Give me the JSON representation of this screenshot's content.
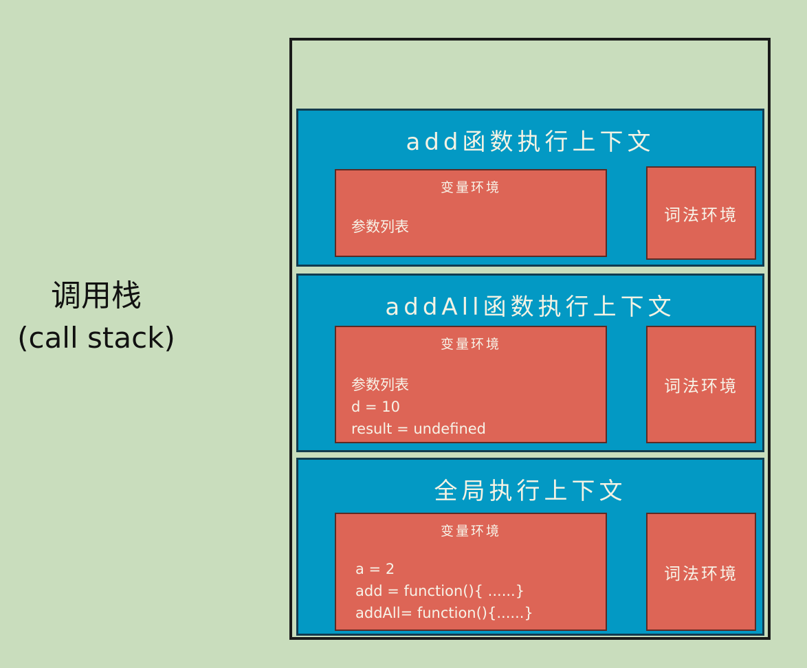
{
  "call_stack_label": {
    "zh": "调用栈",
    "en": "(call stack)"
  },
  "contexts": [
    {
      "title": "add函数执行上下文",
      "variable_env": {
        "title": "变量环境",
        "lines": [
          "参数列表"
        ]
      },
      "lexical_env": "词法环境"
    },
    {
      "title": "addAll函数执行上下文",
      "variable_env": {
        "title": "变量环境",
        "lines": [
          "参数列表",
          "d = 10",
          "result = undefined"
        ]
      },
      "lexical_env": "词法环境"
    },
    {
      "title": "全局执行上下文",
      "variable_env": {
        "title": "变量环境",
        "lines": [
          "a = 2",
          "add = function(){ ......}",
          "addAll= function(){......}"
        ]
      },
      "lexical_env": "词法环境"
    }
  ],
  "colors": {
    "background": "#c9ddbd",
    "context_blue": "#0399c4",
    "env_red": "#dd6556",
    "text_light": "#f4f3e4"
  }
}
